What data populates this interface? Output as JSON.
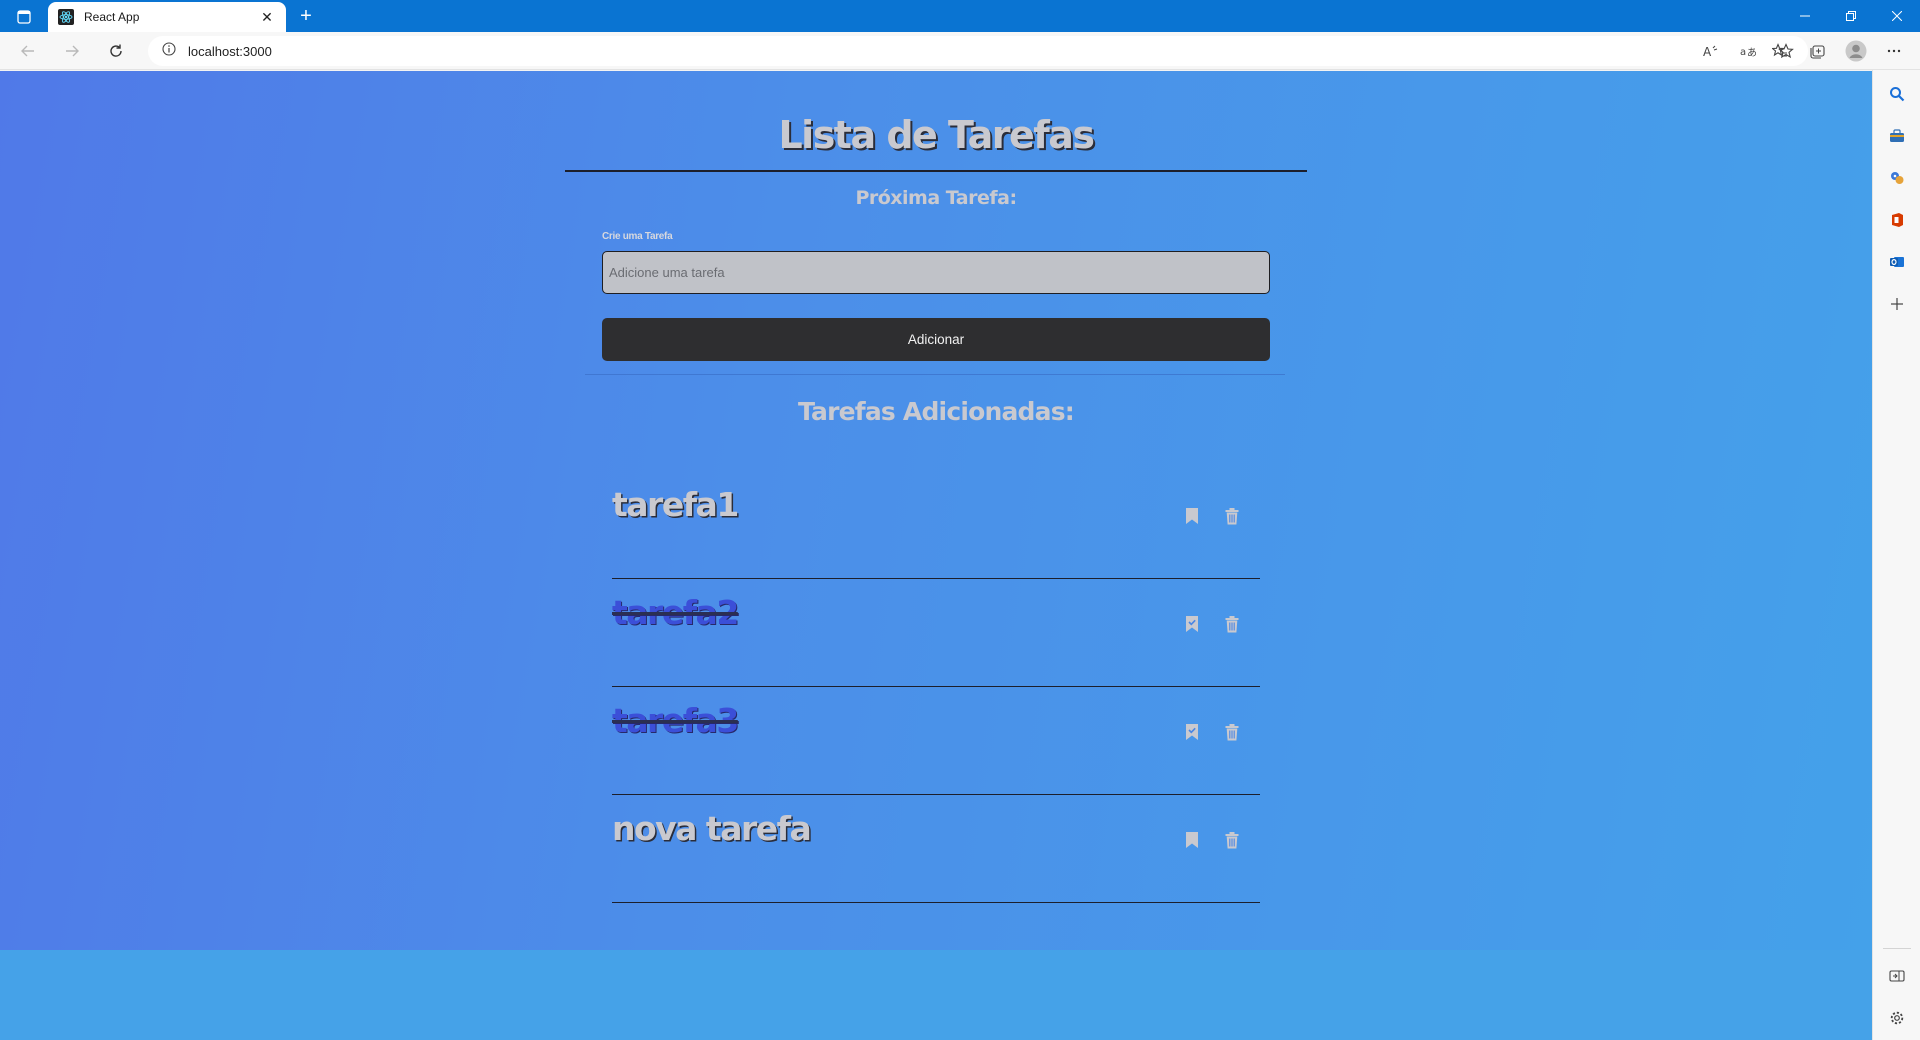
{
  "browser": {
    "tab_title": "React App",
    "tab_close": "✕",
    "new_tab": "+",
    "url": "localhost:3000"
  },
  "page": {
    "title": "Lista de Tarefas",
    "subtitle": "Próxima Tarefa:",
    "input_label": "Crie uma Tarefa",
    "input_placeholder": "Adicione uma tarefa",
    "input_value": "",
    "add_button": "Adicionar",
    "list_title": "Tarefas Adicionadas:"
  },
  "tasks": [
    {
      "name": "tarefa1",
      "completed": false
    },
    {
      "name": "tarefa2",
      "completed": true
    },
    {
      "name": "tarefa3",
      "completed": true
    },
    {
      "name": "nova tarefa",
      "completed": false
    }
  ],
  "colors": {
    "accent": "#0a74d2",
    "page_bg_start": "#5079e8",
    "page_bg_end": "#44a1ea",
    "title_text": "#c9c9cf",
    "completed_text": "#3b4fd8",
    "button_bg": "#2e2e30",
    "input_bg": "#c0c2c8"
  },
  "icons": {
    "bookmark": "bookmark-icon",
    "bookmark_checked": "bookmark-check-icon",
    "trash": "trash-icon"
  }
}
